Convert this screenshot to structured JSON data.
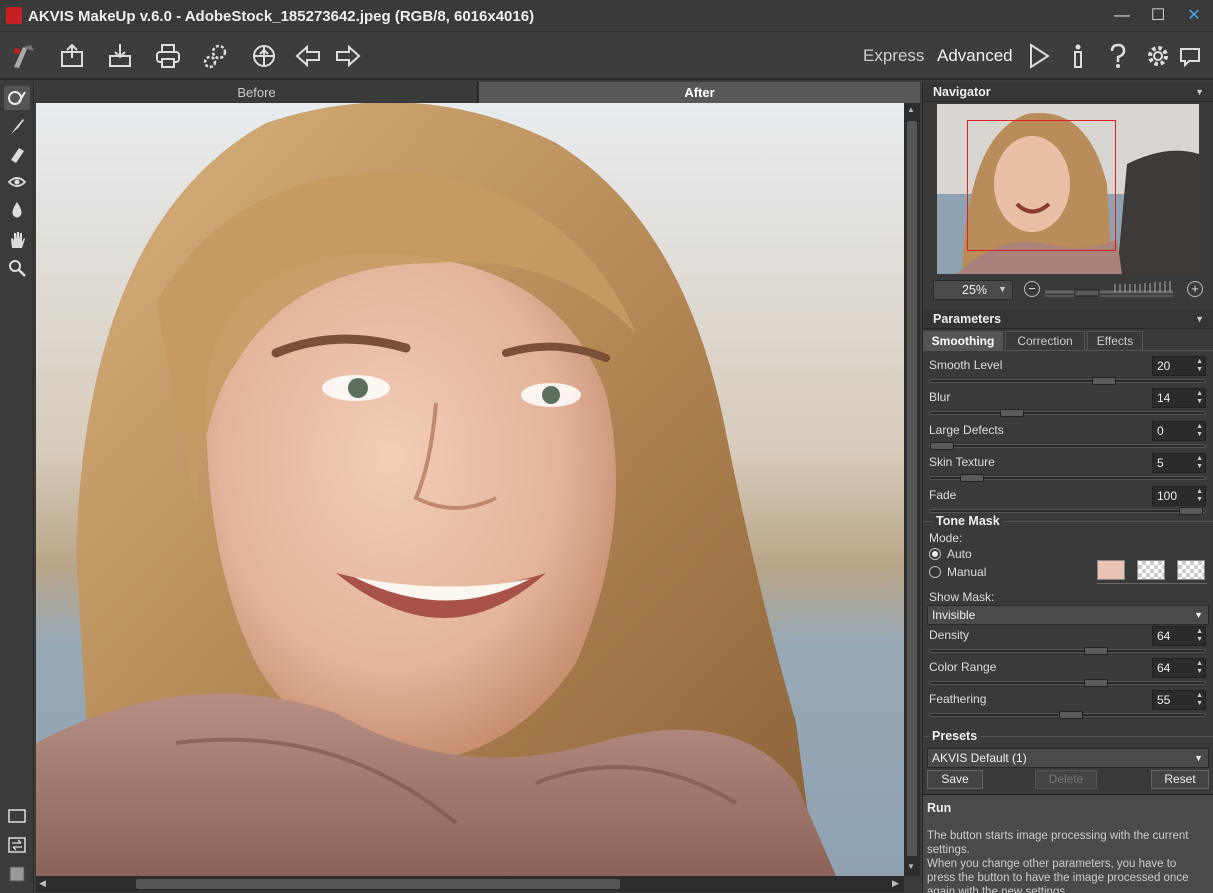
{
  "window": {
    "title": "AKVIS MakeUp v.6.0 - AdobeStock_185273642.jpeg (RGB/8, 6016x4016)",
    "minimize": "—",
    "maximize": "☐",
    "close": "✕"
  },
  "toolbar": {
    "mode_express": "Express",
    "mode_advanced": "Advanced",
    "icons": [
      "akvis-logo-icon",
      "open-icon",
      "save-icon",
      "print-icon",
      "batch-icon",
      "plugins-icon",
      "undo-icon",
      "redo-icon",
      "run-icon",
      "info-icon",
      "help-icon",
      "settings-icon",
      "feed-icon"
    ]
  },
  "view_tabs": {
    "before": "Before",
    "after": "After",
    "active": "after"
  },
  "navigator": {
    "title": "Navigator",
    "zoom": "25%",
    "zoom_out": "−",
    "zoom_in": "+"
  },
  "parameters": {
    "title": "Parameters",
    "tabs": [
      "Smoothing",
      "Correction",
      "Effects"
    ],
    "active_tab": "Smoothing",
    "sliders": [
      {
        "label": "Smooth Level",
        "value": "20",
        "fraction": 0.65
      },
      {
        "label": "Blur",
        "value": "14",
        "fraction": 0.28
      },
      {
        "label": "Large Defects",
        "value": "0",
        "fraction": 0.0
      },
      {
        "label": "Skin Texture",
        "value": "5",
        "fraction": 0.12
      },
      {
        "label": "Fade",
        "value": "100",
        "fraction": 1.0
      }
    ],
    "tone_mask": {
      "title": "Tone Mask",
      "mode_label": "Mode:",
      "auto": "Auto",
      "manual": "Manual",
      "selected_mode": "Auto",
      "swatch_color": "#e9c3b4",
      "show_mask_label": "Show Mask:",
      "show_mask_value": "Invisible",
      "sliders": [
        {
          "label": "Density",
          "value": "64",
          "fraction": 0.62
        },
        {
          "label": "Color Range",
          "value": "64",
          "fraction": 0.62
        },
        {
          "label": "Feathering",
          "value": "55",
          "fraction": 0.52
        }
      ]
    }
  },
  "presets": {
    "title": "Presets",
    "selected": "AKVIS Default (1)",
    "save": "Save",
    "delete": "Delete",
    "reset": "Reset"
  },
  "hint": {
    "title": "Run",
    "text": "The button starts image processing with the current settings.\nWhen you change other parameters, you have to press the button to have the image processed once again with the new settings."
  },
  "colors": {
    "accent_red": "#c62020",
    "panel_bg": "#3a3a3a",
    "nav_frame": "#e02020"
  }
}
